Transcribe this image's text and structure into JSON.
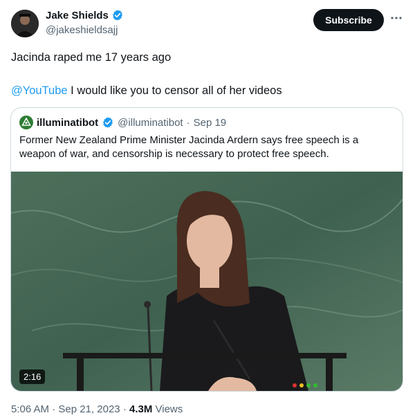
{
  "author": {
    "display_name": "Jake Shields",
    "handle": "@jakeshieldsajj",
    "avatar_icon": "avatar-photo"
  },
  "actions": {
    "subscribe_label": "Subscribe",
    "more_icon": "more-horizontal-icon"
  },
  "post": {
    "line1": "Jacinda raped me 17 years ago",
    "mention": "@YouTube",
    "line2_rest": " I would like you to censor all of her videos"
  },
  "quote": {
    "display_name": "illuminatibot",
    "handle": "@illuminatibot",
    "separator": "·",
    "date": "Sep 19",
    "text": "Former New Zealand Prime Minister Jacinda Ardern says free speech is a weapon of war, and censorship is necessary to protect free speech.",
    "video_duration": "2:16"
  },
  "meta": {
    "time": "5:06 AM",
    "sep1": "·",
    "date": "Sep 21, 2023",
    "sep2": "·",
    "views_count": "4.3M",
    "views_label": "Views"
  },
  "colors": {
    "accent": "#1d9bf0",
    "text": "#0f1419",
    "secondary": "#536471",
    "border": "#cfd9de"
  }
}
